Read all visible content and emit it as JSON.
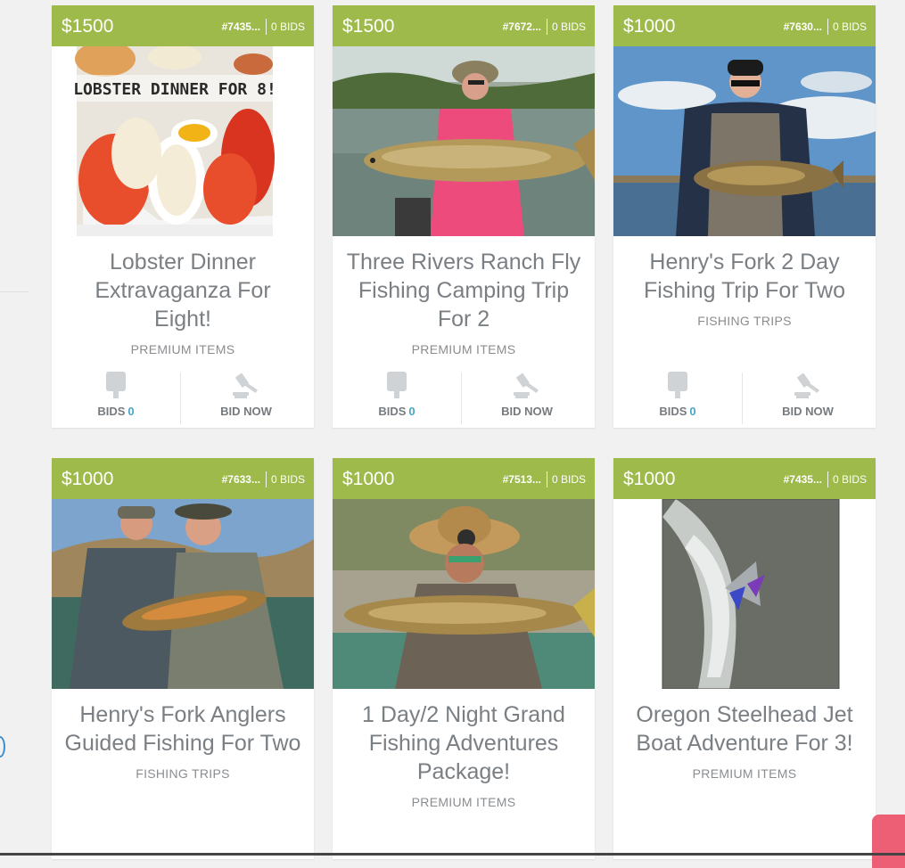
{
  "cards": [
    {
      "price": "$1500",
      "id": "#7435...",
      "bids": "0 BIDS",
      "title": "Lobster Dinner Extravaganza For Eight!",
      "category": "PREMIUM ITEMS",
      "bids_label": "BIDS",
      "bids_num": "0",
      "bid_now": "BID NOW",
      "image_text": "LOBSTER DINNER FOR 8!"
    },
    {
      "price": "$1500",
      "id": "#7672...",
      "bids": "0 BIDS",
      "title": "Three Rivers Ranch Fly Fishing Camping Trip For 2",
      "category": "PREMIUM ITEMS",
      "bids_label": "BIDS",
      "bids_num": "0",
      "bid_now": "BID NOW"
    },
    {
      "price": "$1000",
      "id": "#7630...",
      "bids": "0 BIDS",
      "title": "Henry's Fork 2 Day Fishing Trip For Two",
      "category": "FISHING TRIPS",
      "bids_label": "BIDS",
      "bids_num": "0",
      "bid_now": "BID NOW"
    },
    {
      "price": "$1000",
      "id": "#7633...",
      "bids": "0 BIDS",
      "title": "Henry's Fork Anglers Guided Fishing For Two",
      "category": "FISHING TRIPS"
    },
    {
      "price": "$1000",
      "id": "#7513...",
      "bids": "0 BIDS",
      "title": "1 Day/2 Night Grand Fishing Adventures Package!",
      "category": "PREMIUM ITEMS"
    },
    {
      "price": "$1000",
      "id": "#7435...",
      "bids": "0 BIDS",
      "title": "Oregon Steelhead Jet Boat Adventure For 3!",
      "category": "PREMIUM ITEMS"
    }
  ],
  "colors": {
    "header_green": "#9dba4a",
    "count_blue": "#4aa6c8",
    "pink_tab": "#ec5f75"
  },
  "icons": {
    "bids": "speech-bubble-icon",
    "bid_now": "gavel-icon"
  }
}
